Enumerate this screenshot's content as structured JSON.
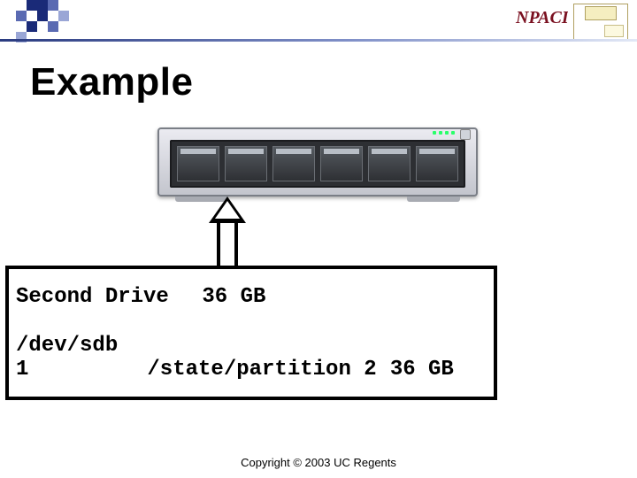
{
  "title": "Example",
  "logo_text": "NPACI",
  "drive": {
    "label": "Second Drive",
    "size": "36 GB"
  },
  "partition": {
    "device": "/dev/sdb 1",
    "mount": "/state/partition 2",
    "size": "36 GB"
  },
  "copyright": "Copyright © 2003 UC Regents"
}
